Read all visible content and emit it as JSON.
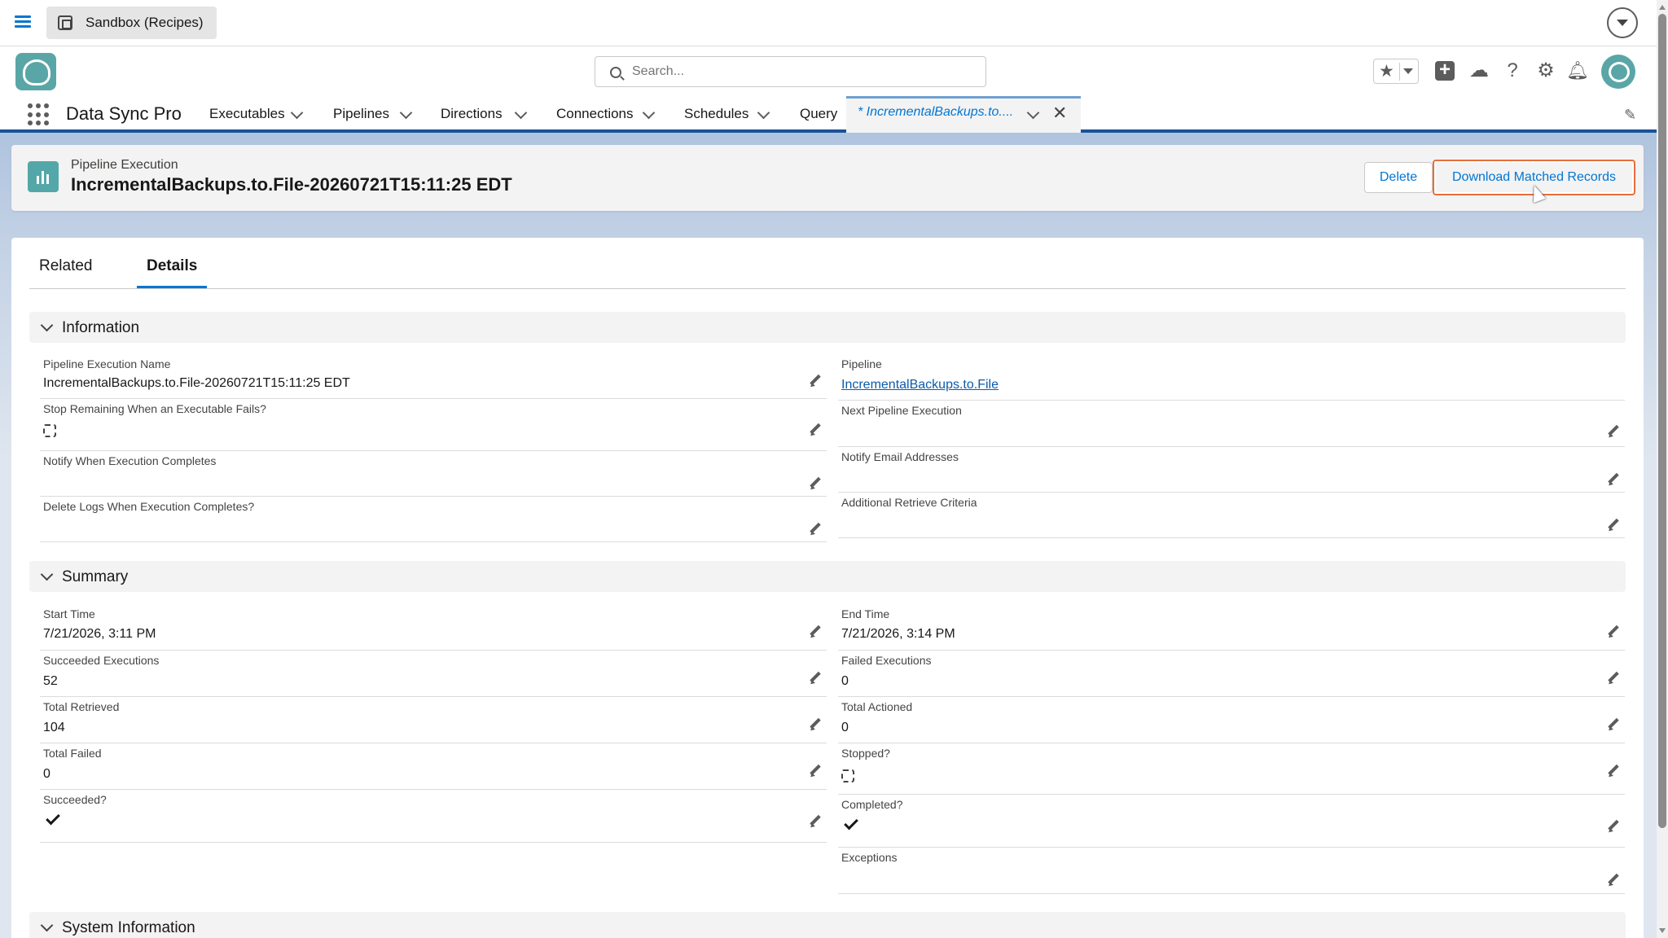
{
  "sandbox": {
    "label": "Sandbox (Recipes)"
  },
  "header": {
    "search_placeholder": "Search...",
    "icons": [
      "favorites-star-icon",
      "add-icon",
      "trailhead-icon",
      "help-icon",
      "setup-gear-icon",
      "notifications-bell-icon",
      "avatar"
    ]
  },
  "nav": {
    "app_name": "Data Sync Pro",
    "items": [
      "Executables",
      "Pipelines",
      "Directions",
      "Connections",
      "Schedules",
      "Query"
    ],
    "active_tab": "* IncrementalBackups.to...."
  },
  "record": {
    "type": "Pipeline Execution",
    "title": "IncrementalBackups.to.File-20260721T15:11:25 EDT",
    "delete_label": "Delete",
    "download_label": "Download Matched Records"
  },
  "tabs": {
    "related": "Related",
    "details": "Details"
  },
  "sections": {
    "information": "Information",
    "summary": "Summary",
    "system": "System Information"
  },
  "information": {
    "exec_name_label": "Pipeline Execution Name",
    "exec_name_value": "IncrementalBackups.to.File-20260721T15:11:25 EDT",
    "pipeline_label": "Pipeline",
    "pipeline_value": "IncrementalBackups.to.File",
    "stop_label": "Stop Remaining When an Executable Fails?",
    "stop_checked": false,
    "next_label": "Next Pipeline Execution",
    "notify_label": "Notify When Execution Completes",
    "notify_email_label": "Notify Email Addresses",
    "delete_logs_label": "Delete Logs When Execution Completes?",
    "additional_label": "Additional Retrieve Criteria"
  },
  "summary": {
    "start_label": "Start Time",
    "start_value": "7/21/2026, 3:11 PM",
    "end_label": "End Time",
    "end_value": "7/21/2026, 3:14 PM",
    "succeeded_exec_label": "Succeeded Executions",
    "succeeded_exec_value": "52",
    "failed_exec_label": "Failed Executions",
    "failed_exec_value": "0",
    "total_retrieved_label": "Total Retrieved",
    "total_retrieved_value": "104",
    "total_actioned_label": "Total Actioned",
    "total_actioned_value": "0",
    "total_failed_label": "Total Failed",
    "total_failed_value": "0",
    "stopped_label": "Stopped?",
    "stopped_checked": false,
    "succeeded_label": "Succeeded?",
    "succeeded_checked": true,
    "completed_label": "Completed?",
    "completed_checked": true,
    "exceptions_label": "Exceptions"
  }
}
